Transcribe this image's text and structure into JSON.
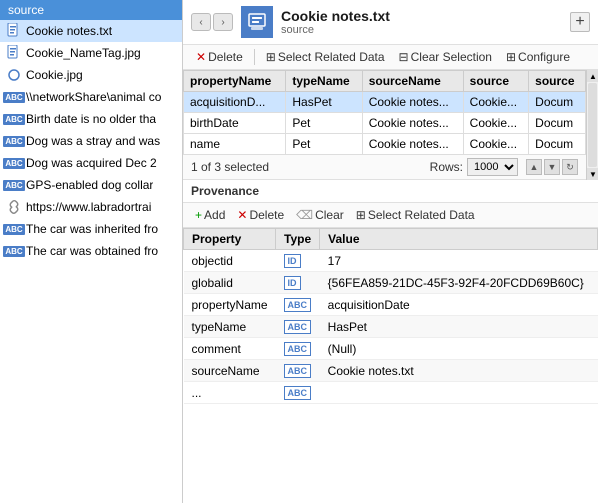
{
  "left_panel": {
    "header": "source",
    "items": [
      {
        "id": "cookie-notes-txt",
        "icon": "doc",
        "label": "Cookie notes.txt",
        "selected": true
      },
      {
        "id": "cookie-nametag-jpg",
        "icon": "doc",
        "label": "Cookie_NameTag.jpg",
        "selected": false
      },
      {
        "id": "cookie-jpg",
        "icon": "circle",
        "label": "Cookie.jpg",
        "selected": false
      },
      {
        "id": "network-share",
        "icon": "abc",
        "label": "\\\\networkShare\\animal co",
        "selected": false
      },
      {
        "id": "birth-date",
        "icon": "abc",
        "label": "Birth date is no older tha",
        "selected": false
      },
      {
        "id": "dog-stray",
        "icon": "abc",
        "label": "Dog was a stray and was",
        "selected": false
      },
      {
        "id": "dog-acquired",
        "icon": "abc",
        "label": "Dog was acquired Dec 2",
        "selected": false
      },
      {
        "id": "gps-collar",
        "icon": "abc",
        "label": "GPS-enabled dog collar",
        "selected": false
      },
      {
        "id": "labrador-train",
        "icon": "link",
        "label": "https://www.labradortrai",
        "selected": false
      },
      {
        "id": "car-inherited",
        "icon": "abc",
        "label": "The car was inherited fro",
        "selected": false
      },
      {
        "id": "car-obtained",
        "icon": "abc",
        "label": "The car was obtained fro",
        "selected": false
      }
    ]
  },
  "right_panel": {
    "title": "Cookie notes.txt",
    "subtitle": "source",
    "toolbar": {
      "delete_label": "Delete",
      "select_related_label": "Select Related Data",
      "clear_selection_label": "Clear Selection",
      "configure_label": "Configure"
    },
    "table": {
      "columns": [
        "propertyName",
        "typeName",
        "sourceName",
        "source",
        "source"
      ],
      "rows": [
        {
          "propertyName": "acquisitionD...",
          "typeName": "HasPet",
          "sourceName": "Cookie notes...",
          "source": "Cookie...",
          "source2": "Docum",
          "selected": true
        },
        {
          "propertyName": "birthDate",
          "typeName": "Pet",
          "sourceName": "Cookie notes...",
          "source": "Cookie...",
          "source2": "Docum",
          "selected": false
        },
        {
          "propertyName": "name",
          "typeName": "Pet",
          "sourceName": "Cookie notes...",
          "source": "Cookie...",
          "source2": "Docum",
          "selected": false
        }
      ],
      "footer": {
        "selected_text": "1 of 3 selected",
        "rows_label": "Rows:",
        "rows_value": "1000"
      }
    },
    "provenance": {
      "header": "Provenance",
      "toolbar": {
        "add_label": "Add",
        "delete_label": "Delete",
        "clear_label": "Clear",
        "select_related_label": "Select Related Data"
      },
      "table": {
        "columns": [
          "Property",
          "Type",
          "Value"
        ],
        "rows": [
          {
            "property": "objectid",
            "type": "ID",
            "value": "17"
          },
          {
            "property": "globalid",
            "type": "ID",
            "value": "{56FEA859-21DC-45F3-92F4-20FCDD69B60C}"
          },
          {
            "property": "propertyName",
            "type": "ABC",
            "value": "acquisitionDate"
          },
          {
            "property": "typeName",
            "type": "ABC",
            "value": "HasPet"
          },
          {
            "property": "comment",
            "type": "ABC",
            "value": "(Null)"
          },
          {
            "property": "sourceName",
            "type": "ABC",
            "value": "Cookie notes.txt"
          },
          {
            "property": "...",
            "type": "ABC",
            "value": ""
          }
        ]
      }
    }
  }
}
